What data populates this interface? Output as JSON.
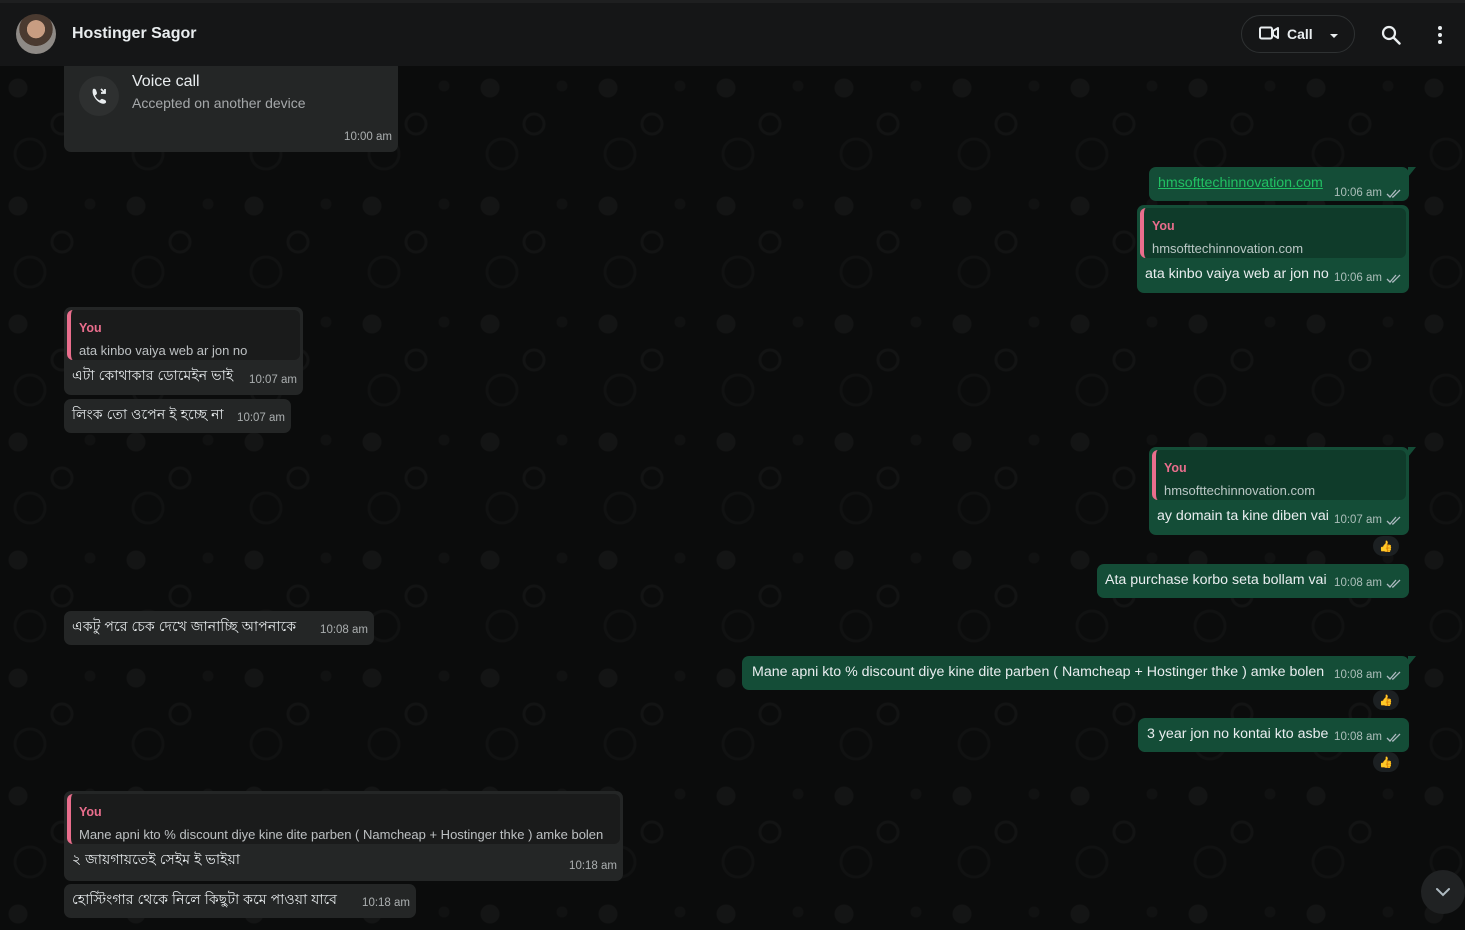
{
  "header": {
    "contact_name": "Hostinger Sagor",
    "call_label": "Call"
  },
  "messages": {
    "voice_call": {
      "title": "Voice call",
      "subtitle": "Accepted on another device",
      "time": "10:00 am"
    },
    "m1": {
      "text": "hmsofttechinnovation.com",
      "time": "10:06 am"
    },
    "m2": {
      "quote_author": "You",
      "quote_text": "hmsofttechinnovation.com",
      "text": "ata kinbo vaiya web ar jon no",
      "time": "10:06 am"
    },
    "m3": {
      "quote_author": "You",
      "quote_text": "ata kinbo vaiya web ar jon no",
      "text": "এটা কোথাকার ডোমেইন ভাই",
      "time": "10:07 am"
    },
    "m4": {
      "text": "লিংক তো ওপেন ই হচ্ছে না",
      "time": "10:07 am"
    },
    "m5": {
      "quote_author": "You",
      "quote_text": "hmsofttechinnovation.com",
      "text": "ay domain ta kine diben vai",
      "time": "10:07 am"
    },
    "m6": {
      "text": "Ata purchase korbo seta bollam vai",
      "time": "10:08 am"
    },
    "m7": {
      "text": "একটু পরে চেক দেখে জানাচ্ছি আপনাকে",
      "time": "10:08 am"
    },
    "m8": {
      "text": "Mane apni kto % discount diye kine dite parben ( Namcheap + Hostinger thke )  amke bolen",
      "time": "10:08 am"
    },
    "m9": {
      "text": "3 year jon no kontai kto asbe",
      "time": "10:08 am"
    },
    "m10": {
      "quote_author": "You",
      "quote_text": "Mane apni kto % discount diye kine dite parben ( Namcheap + Hostinger thke )  amke bolen",
      "text": "২ জায়গায়তেই সেইম ই ভাইয়া",
      "time": "10:18 am"
    },
    "m11": {
      "text": "হোস্টিংগার  থেকে নিলে কিছুটা কমে পাওয়া যাবে",
      "time": "10:18 am"
    }
  },
  "reaction": "👍",
  "icons": {
    "video": "video-camera-icon",
    "dropdown": "chevron-down-icon",
    "search": "search-icon",
    "menu": "vertical-dots-icon",
    "call_accepted": "incoming-call-icon",
    "double_tick": "double-check-icon",
    "scroll_down": "chevron-down-icon"
  },
  "colors": {
    "outgoing_bubble": "#144d37",
    "incoming_bubble": "#242626",
    "quote_accent": "#ea6e8d",
    "link": "#21c063"
  }
}
